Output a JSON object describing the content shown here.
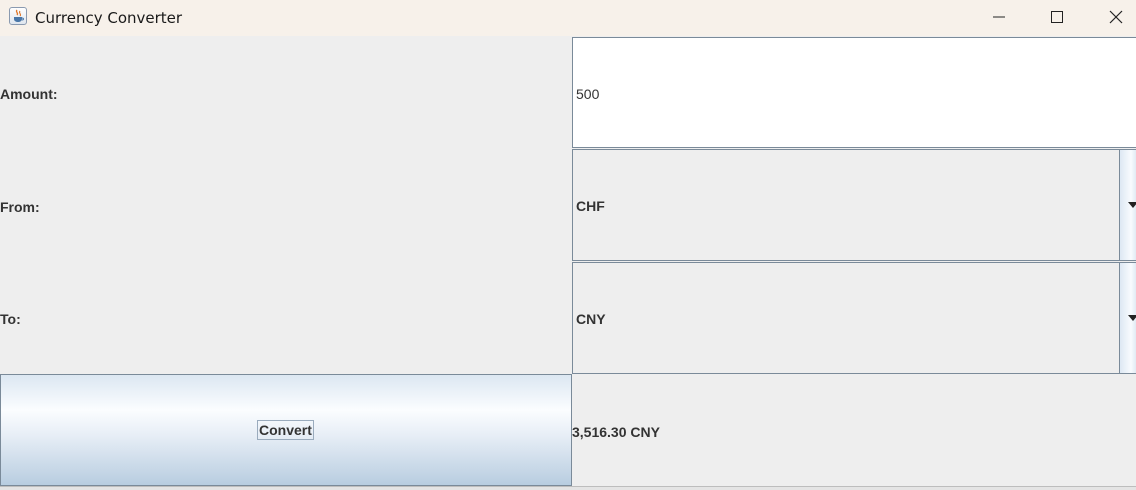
{
  "window": {
    "title": "Currency Converter",
    "icon": "java-cup-icon",
    "controls": [
      "minimize-icon",
      "maximize-icon",
      "close-icon"
    ]
  },
  "form": {
    "amount_label": "Amount:",
    "amount_value": "500",
    "from_label": "From:",
    "from_value": "CHF",
    "to_label": "To:",
    "to_value": "CNY",
    "convert_label": "Convert",
    "result": "3,516.30 CNY"
  },
  "colors": {
    "background": "#eeeeee",
    "titlebar": "#f7f1ea",
    "border": "#7a8a99",
    "text": "#333333"
  }
}
